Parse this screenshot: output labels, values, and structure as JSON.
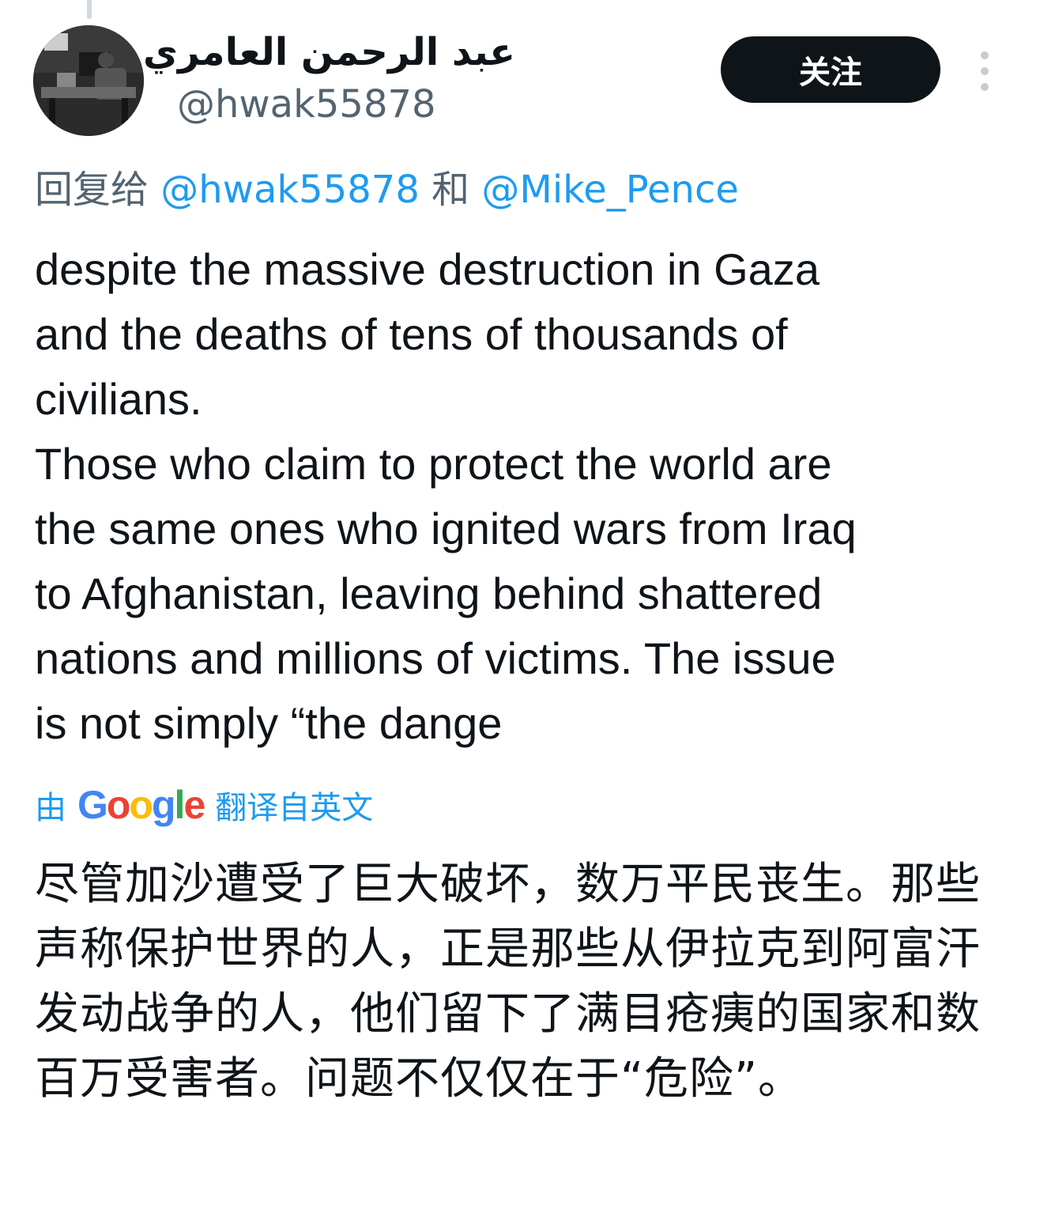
{
  "author": {
    "display_name": "عبد الرحمن العامري",
    "handle": "@hwak55878"
  },
  "follow_button": {
    "label": "关注"
  },
  "more_menu": {
    "icon": "more-vertical-icon"
  },
  "reply_context": {
    "prefix": "回复给",
    "mention_1": "@hwak55878",
    "conjunction": "和",
    "mention_2": "@Mike_Pence"
  },
  "tweet": {
    "text": "despite the massive destruction in Gaza\nand the deaths of tens of thousands of\ncivilians.\nThose who claim to protect the world are\nthe same ones who ignited wars from Iraq\nto Afghanistan, leaving behind shattered\nnations and millions of victims. The issue\nis not simply “the dange"
  },
  "translation": {
    "prefix": "由",
    "provider": "Google",
    "suffix": "翻译自英文",
    "text": "尽管加沙遭受了巨大破坏，数万平民丧生。那些声称保护世界的人，正是那些从伊拉克到阿富汗发动战争的人，他们留下了满目疮痍的国家和数百万受害者。问题不仅仅在于“危险”。"
  },
  "colors": {
    "text_primary": "#0f1419",
    "text_secondary": "#536471",
    "link": "#1d9bf0",
    "button_bg": "#0f1419"
  }
}
